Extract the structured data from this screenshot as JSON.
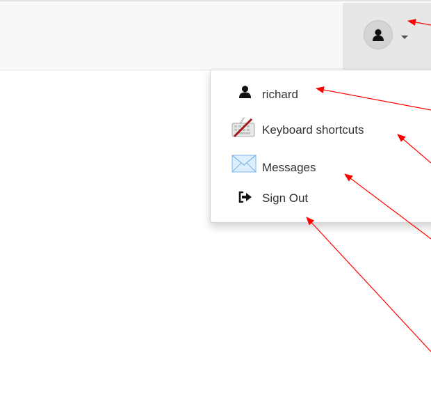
{
  "menu": {
    "user": {
      "label": "richard",
      "icon": "user-icon"
    },
    "shortcuts": {
      "label": "Keyboard shortcuts",
      "icon": "keyboard-icon"
    },
    "messages": {
      "label": "Messages",
      "icon": "envelope-icon"
    },
    "signout": {
      "label": "Sign Out",
      "icon": "sign-out-icon"
    }
  },
  "header": {
    "avatar_icon": "user-icon",
    "toggle_icon": "caret-down-icon"
  },
  "colors": {
    "annotation": "#ff0000",
    "menu_text": "#333333"
  }
}
